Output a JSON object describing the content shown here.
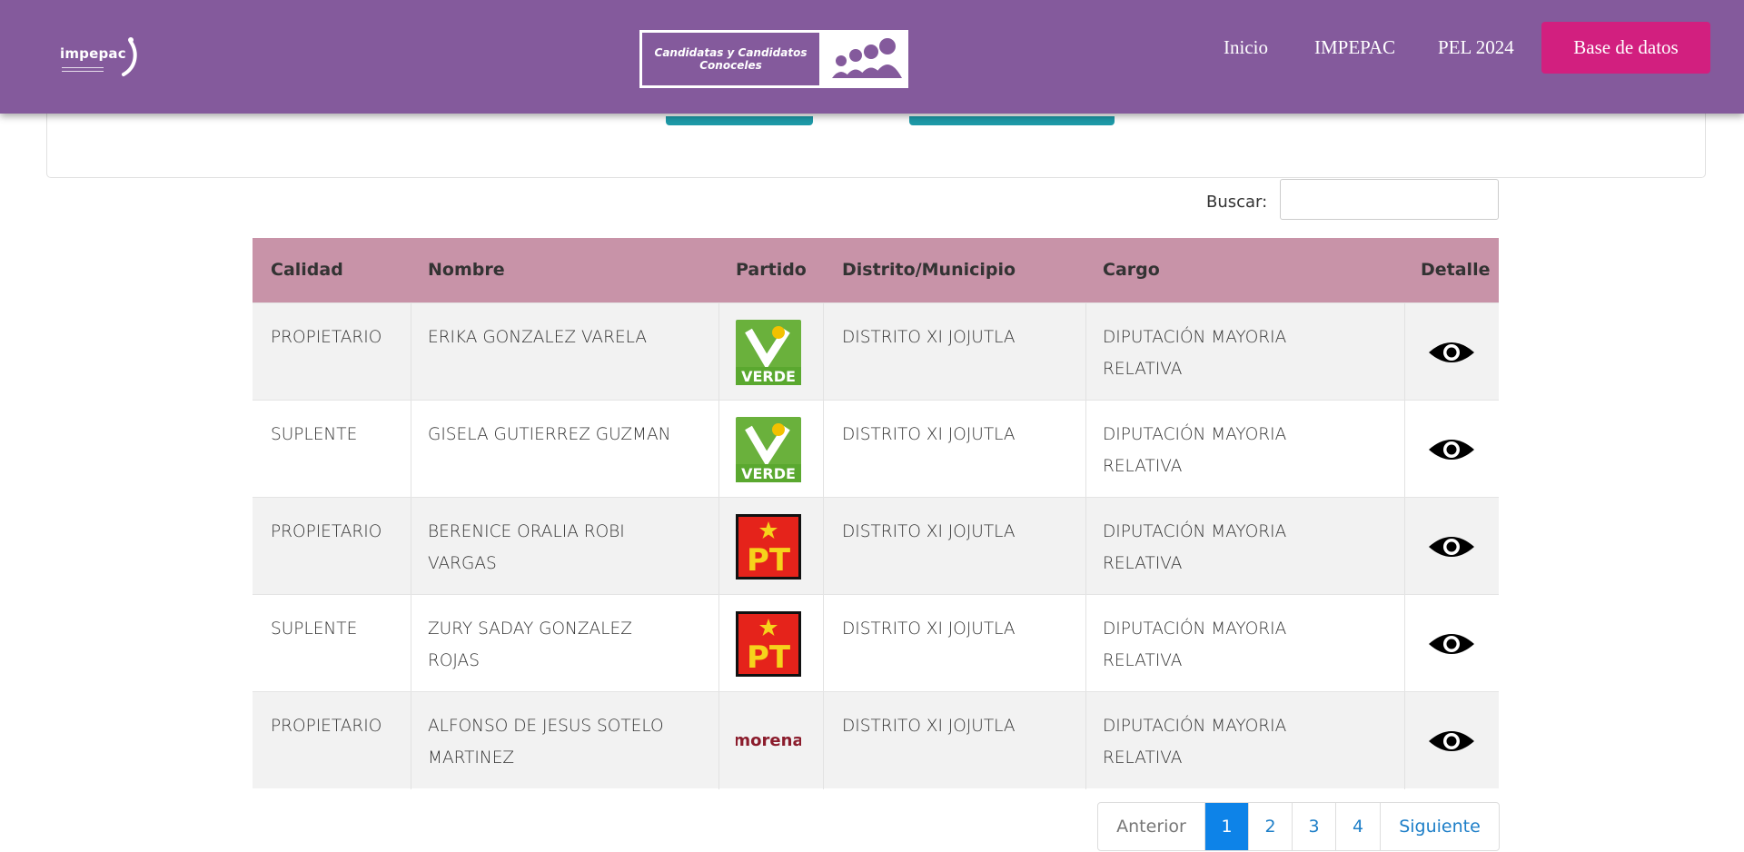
{
  "navbar": {
    "brand": "impepac",
    "center_logo_text": "Candidatas y Candidatos Conoceles",
    "links": [
      "Inicio",
      "IMPEPAC",
      "PEL 2024"
    ],
    "cta": "Base de datos"
  },
  "search": {
    "label": "Buscar:",
    "value": ""
  },
  "table": {
    "headers": [
      "Calidad",
      "Nombre",
      "Partido",
      "Distrito/Municipio",
      "Cargo",
      "Detalle"
    ],
    "rows": [
      {
        "calidad": "PROPIETARIO",
        "nombre_1": "ERIKA GONZALEZ VARELA",
        "nombre_2": "",
        "partido": "VERDE",
        "distrito": "DISTRITO XI JOJUTLA",
        "cargo_1": "DIPUTACIÓN MAYORIA",
        "cargo_2": "RELATIVA"
      },
      {
        "calidad": "SUPLENTE",
        "nombre_1": "GISELA GUTIERREZ GUZMAN",
        "nombre_2": "",
        "partido": "VERDE",
        "distrito": "DISTRITO XI JOJUTLA",
        "cargo_1": "DIPUTACIÓN MAYORIA",
        "cargo_2": "RELATIVA"
      },
      {
        "calidad": "PROPIETARIO",
        "nombre_1": "BERENICE ORALIA ROBI",
        "nombre_2": "VARGAS",
        "partido": "PT",
        "distrito": "DISTRITO XI JOJUTLA",
        "cargo_1": "DIPUTACIÓN MAYORIA",
        "cargo_2": "RELATIVA"
      },
      {
        "calidad": "SUPLENTE",
        "nombre_1": "ZURY SADAY GONZALEZ",
        "nombre_2": "ROJAS",
        "partido": "PT",
        "distrito": "DISTRITO XI JOJUTLA",
        "cargo_1": "DIPUTACIÓN MAYORIA",
        "cargo_2": "RELATIVA"
      },
      {
        "calidad": "PROPIETARIO",
        "nombre_1": "ALFONSO DE JESUS SOTELO",
        "nombre_2": "MARTINEZ",
        "partido": "morena",
        "distrito": "DISTRITO XI JOJUTLA",
        "cargo_1": "DIPUTACIÓN MAYORIA",
        "cargo_2": "RELATIVA"
      }
    ],
    "detail_icon": "eye-icon"
  },
  "pagination": {
    "prev": "Anterior",
    "pages": [
      "1",
      "2",
      "3",
      "4"
    ],
    "active": "1",
    "next": "Siguiente"
  },
  "colors": {
    "navbar": "#845a9c",
    "cta": "#d21f7f",
    "table_header": "#c893a8",
    "active_page": "#0d83e8"
  }
}
